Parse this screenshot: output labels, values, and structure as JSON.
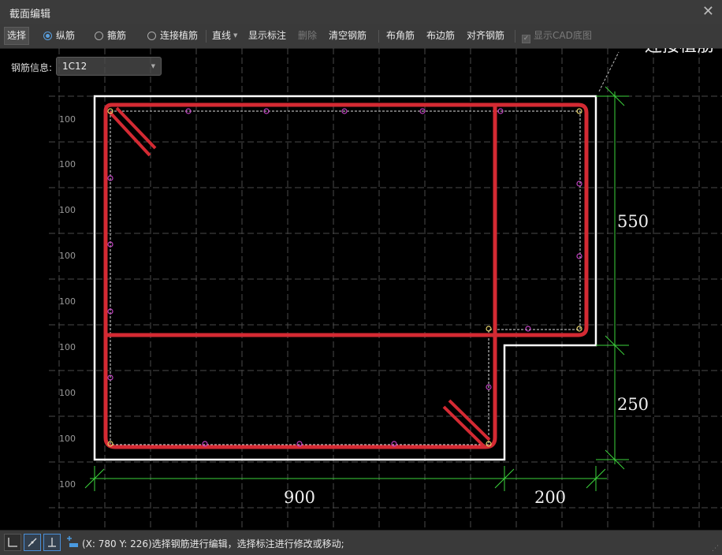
{
  "window": {
    "title": "截面编辑",
    "close_glyph": "✕"
  },
  "toolbar": {
    "select_label": "选择",
    "radio_longitudinal": "纵筋",
    "radio_stirrup": "箍筋",
    "radio_connect": "连接植筋",
    "line_mode_label": "直线",
    "show_annotation_label": "显示标注",
    "delete_label": "删除",
    "clear_rebar_label": "清空钢筋",
    "corner_rebar_label": "布角筋",
    "edge_rebar_label": "布边筋",
    "align_rebar_label": "对齐钢筋",
    "show_cad_label": "显示CAD底图",
    "selected_radio": "纵筋"
  },
  "rebar_info": {
    "label": "钢筋信息:",
    "value": "1C12"
  },
  "drawing": {
    "grid_labels": [
      "100",
      "100",
      "100",
      "100",
      "100",
      "100",
      "100",
      "100",
      "100"
    ],
    "dim_horizontal": [
      "900",
      "200"
    ],
    "dim_vertical": [
      "550",
      "250"
    ],
    "partial_label": "连接植筋",
    "colors": {
      "rebar": "#d42a33",
      "outline": "#ffffff",
      "dimension": "#3dd43d",
      "grid": "#4a4a4a",
      "point": "#c040c0"
    }
  },
  "status": {
    "text": "(X: 780 Y: 226)选择钢筋进行编辑，选择标注进行修改或移动;"
  },
  "status_tools": [
    "angle-tool-icon",
    "snap-line-icon",
    "perpendicular-icon",
    "add-dimension-icon"
  ]
}
